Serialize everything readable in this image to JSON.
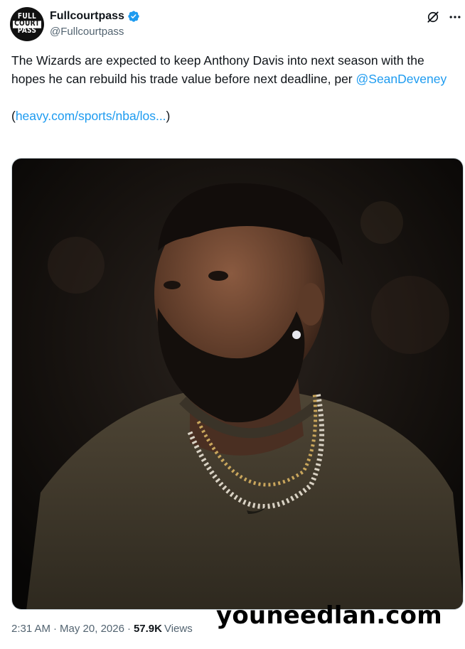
{
  "author": {
    "display_name": "Fullcourtpass",
    "handle": "@Fullcourtpass",
    "verified": true,
    "avatar_lines": [
      "FULL",
      "COURT",
      "PASS"
    ]
  },
  "header_icons": [
    "grok-icon",
    "more-options-icon"
  ],
  "tweet": {
    "text_line1": "The Wizards are expected to keep Anthony Davis into next season with the hopes he can rebuild his trade value before next deadline, per",
    "mention": "@SeanDeveney",
    "open_paren": "(",
    "link_text": "heavy.com/sports/nba/los...",
    "close_paren": ")"
  },
  "meta": {
    "time": "2:31 AM",
    "separator": "·",
    "date": "May 20, 2026",
    "views_count": "57.9K",
    "views_label": "Views"
  },
  "watermark": "youneedlan.com",
  "colors": {
    "link": "#1d9bf0",
    "text": "#0f1419",
    "secondary": "#536471",
    "verified": "#1d9bf0"
  }
}
